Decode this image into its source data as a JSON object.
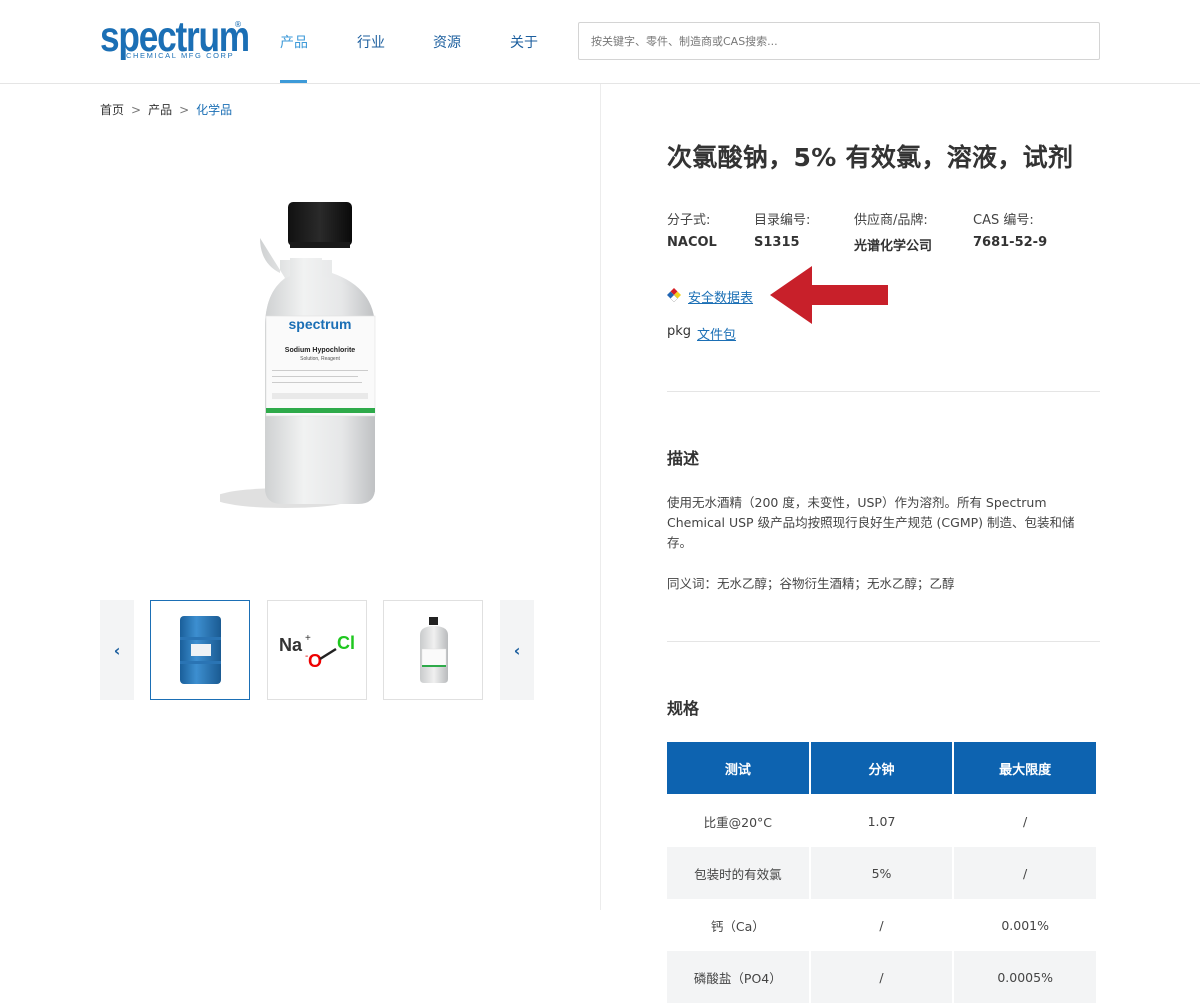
{
  "header": {
    "logo_text": "spectrum",
    "logo_subtitle": "CHEMICAL MFG CORP",
    "logo_reg": "®",
    "nav": [
      {
        "label": "产品"
      },
      {
        "label": "行业"
      },
      {
        "label": "资源"
      },
      {
        "label": "关于"
      }
    ],
    "active_nav": "产品",
    "search_placeholder": "按关键字、零件、制造商或CAS搜索..."
  },
  "breadcrumb": {
    "items": [
      "首页",
      "产品",
      "化学品"
    ],
    "separator": ">"
  },
  "gallery": {
    "main_label_brand": "spectrum",
    "main_label_product": "Sodium Hypochlorite",
    "main_label_sub": "Solution, Reagent",
    "thumb_chem": {
      "na": "Na",
      "plus": "+",
      "minus": "-",
      "o": "O",
      "cl": "Cl"
    },
    "prev_icon": "‹",
    "next_icon": "‹"
  },
  "product": {
    "title": "次氯酸钠，5% 有效氯，溶液，试剂",
    "attributes": [
      {
        "label": "分子式:",
        "value": "NACOL"
      },
      {
        "label": "目录编号:",
        "value": "S1315"
      },
      {
        "label": "供应商/品牌:",
        "value": "光谱化学公司"
      },
      {
        "label": "CAS 编号:",
        "value": "7681-52-9"
      }
    ],
    "sds_link": "安全数据表",
    "pkg_label": "pkg",
    "pkg_link": "文件包"
  },
  "description": {
    "title": "描述",
    "text": "使用无水酒精（200 度，未变性，USP）作为溶剂。所有 Spectrum Chemical USP 级产品均按照现行良好生产规范 (CGMP) 制造、包装和储存。",
    "synonyms": "同义词：无水乙醇；谷物衍生酒精；无水乙醇；乙醇"
  },
  "specs": {
    "title": "规格",
    "columns": [
      "测试",
      "分钟",
      "最大限度"
    ],
    "rows": [
      [
        "比重@20°C",
        "1.07",
        "/"
      ],
      [
        "包装时的有效氯",
        "5%",
        "/"
      ],
      [
        "钙（Ca）",
        "/",
        "0.001%"
      ],
      [
        "磷酸盐（PO4）",
        "/",
        "0.0005%"
      ]
    ]
  },
  "colors": {
    "brand_blue": "#1b6fb5",
    "table_header": "#0d63b0",
    "arrow_red": "#c8202a"
  }
}
